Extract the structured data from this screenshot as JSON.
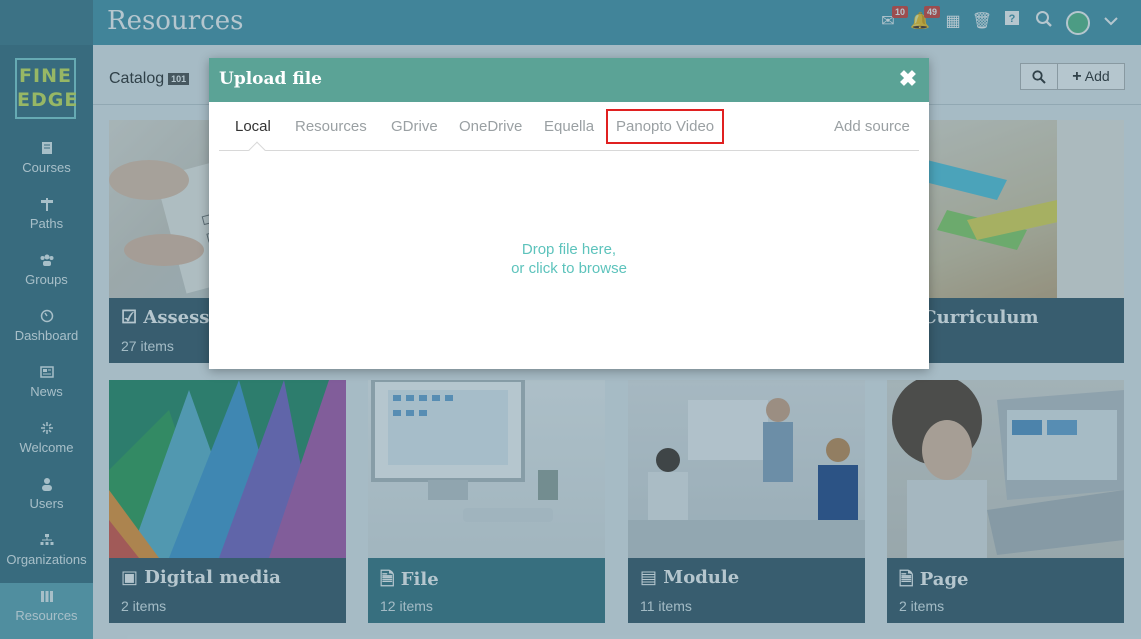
{
  "header": {
    "title": "Resources",
    "mail_badge": "10",
    "notifications_badge": "49"
  },
  "sidebar": {
    "brand_top": "FINE",
    "brand_bottom": "EDGE",
    "items": [
      {
        "label": "Courses",
        "icon": "book-icon"
      },
      {
        "label": "Paths",
        "icon": "signpost-icon"
      },
      {
        "label": "Groups",
        "icon": "users-group-icon"
      },
      {
        "label": "Dashboard",
        "icon": "gauge-icon"
      },
      {
        "label": "News",
        "icon": "newspaper-icon"
      },
      {
        "label": "Welcome",
        "icon": "sparkle-icon"
      },
      {
        "label": "Users",
        "icon": "user-icon"
      },
      {
        "label": "Organizations",
        "icon": "org-chart-icon"
      },
      {
        "label": "Resources",
        "icon": "library-icon",
        "active": true
      }
    ]
  },
  "catalog": {
    "tab_label": "Catalog",
    "count": "101",
    "add_label": "Add"
  },
  "cards": [
    {
      "title": "Assessm",
      "count": "27 items"
    },
    {
      "title": "Curriculum",
      "count": "ms"
    },
    {
      "title": "Digital media",
      "count": "2 items"
    },
    {
      "title": "File",
      "count": "12 items"
    },
    {
      "title": "Module",
      "count": "11 items"
    },
    {
      "title": "Page",
      "count": "2 items"
    }
  ],
  "modal": {
    "title": "Upload file",
    "tabs": [
      "Local",
      "Resources",
      "GDrive",
      "OneDrive",
      "Equella",
      "Panopto Video"
    ],
    "add_source": "Add source",
    "drop_line1": "Drop file here,",
    "drop_line2": "or click to browse"
  },
  "colors": {
    "topbar": "#4d9aae",
    "sidebar": "#3f7385",
    "modal_header": "#5ba396",
    "drop_text": "#5dc3bc",
    "highlight": "#e02020"
  }
}
